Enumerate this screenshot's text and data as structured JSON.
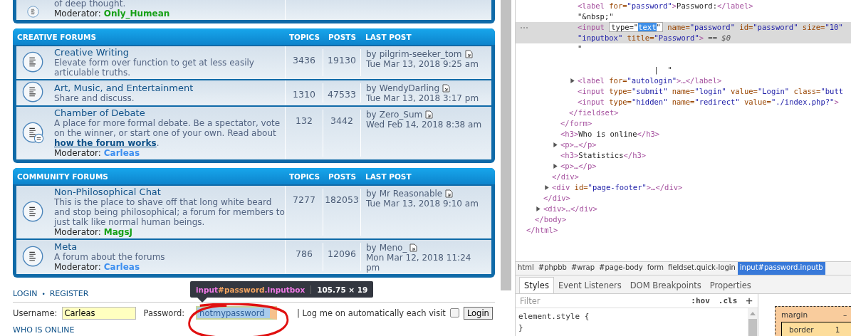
{
  "forum": {
    "categories": [
      {
        "forums": [
          {
            "description": [
              {
                "kind": "text",
                "text": "of deep thought."
              }
            ],
            "moderator_label": "Moderator:",
            "moderator": {
              "name": "Only_Humean",
              "color": "#16a016"
            },
            "has_badge": false
          }
        ]
      },
      {
        "title": "CREATIVE FORUMS",
        "columns": [
          "TOPICS",
          "POSTS",
          "LAST POST"
        ],
        "forums": [
          {
            "name": "Creative Writing",
            "description": [
              {
                "kind": "text",
                "text": "Elevate form over function to get at less easily articulable truths."
              }
            ],
            "has_badge": false,
            "topics": "3436",
            "posts": "19130",
            "last_post": {
              "by": "by",
              "user": "pilgrim-seeker_tom",
              "date": "Tue Mar 13, 2018 9:25 am"
            }
          },
          {
            "name": "Art, Music, and Entertainment",
            "description": [
              {
                "kind": "text",
                "text": "Share and discuss."
              }
            ],
            "has_badge": false,
            "topics": "1310",
            "posts": "47533",
            "last_post": {
              "by": "by",
              "user": "WendyDarling",
              "date": "Tue Mar 13, 2018 3:17 pm"
            }
          },
          {
            "name": "Chamber of Debate",
            "description": [
              {
                "kind": "text",
                "text": "A place for more formal debate. Be a spectator, vote on the winner, or start one of your own. Read about "
              },
              {
                "kind": "link",
                "text": "how the forum works"
              },
              {
                "kind": "text",
                "text": "."
              }
            ],
            "moderator_label": "Moderator:",
            "moderator": {
              "name": "Carleas",
              "color": "#3d8ff0"
            },
            "has_badge": true,
            "topics": "132",
            "posts": "3442",
            "last_post": {
              "by": "by",
              "user": "Zero_Sum",
              "date": "Wed Feb 14, 2018 8:38 am"
            }
          }
        ]
      },
      {
        "title": "COMMUNITY FORUMS",
        "columns": [
          "TOPICS",
          "POSTS",
          "LAST POST"
        ],
        "forums": [
          {
            "name": "Non-Philosophical Chat",
            "description": [
              {
                "kind": "text",
                "text": "This is the place to shave off that long white beard and stop being philosophical; a forum for members to just talk like normal human beings."
              }
            ],
            "moderator_label": "Moderator:",
            "moderator": {
              "name": "MagsJ",
              "color": "#16a016"
            },
            "has_badge": false,
            "topics": "7277",
            "posts": "182053",
            "last_post": {
              "by": "by",
              "user": "Mr Reasonable",
              "date": "Tue Mar 13, 2018 9:10 am"
            }
          },
          {
            "name": "Meta",
            "description": [
              {
                "kind": "text",
                "text": "A forum about the forums"
              }
            ],
            "moderator_label": "Moderator:",
            "moderator": {
              "name": "Carleas",
              "color": "#3d8ff0"
            },
            "has_badge": false,
            "topics": "786",
            "posts": "12096",
            "last_post": {
              "by": "by",
              "user": "Meno_",
              "date": "Mon Mar 12, 2018 11:24 pm"
            }
          }
        ]
      }
    ],
    "login": {
      "links": [
        "LOGIN",
        "REGISTER"
      ],
      "separator": "•",
      "username_label": "Username:",
      "username": "Carleas",
      "password_label": "Password:",
      "password": "notmypassword",
      "autologin_label": "| Log me on automatically each visit",
      "autologin_checked": false,
      "button": "Login"
    },
    "tooltip": {
      "tag": "input",
      "id": "#password",
      "class": ".inputbox",
      "size": "105.75 × 19"
    },
    "next_heading": "WHO IS ONLINE"
  },
  "devtools": {
    "dom_tree": {
      "selected": false,
      "close": [
        {
          "kind": "tag",
          "text": "</html>"
        }
      ],
      "children": [
        {
          "selected": false,
          "close": [
            {
              "kind": "tag",
              "text": "</body>"
            }
          ],
          "children": [
            {
              "selected": false,
              "close": [
                {
                  "kind": "tag",
                  "text": "</div>"
                }
              ],
              "children": [
                {
                  "selected": false,
                  "close": [
                    {
                      "kind": "tag",
                      "text": "</div>"
                    }
                  ],
                  "children": [
                    {
                      "selected": false,
                      "close": [
                        {
                          "kind": "tag",
                          "text": "</form>"
                        }
                      ],
                      "children": [
                        {
                          "selected": false,
                          "close": [
                            {
                              "kind": "tag",
                              "text": "</fieldset>"
                            }
                          ],
                          "children": [
                            {
                              "selected": false,
                              "lines": [
                                [
                                  {
                                    "kind": "tag",
                                    "text": "<label"
                                  },
                                  {
                                    "kind": "attr",
                                    "text": " for="
                                  },
                                  {
                                    "kind": "value",
                                    "text": "\"password\""
                                  },
                                  {
                                    "kind": "tag",
                                    "text": ">"
                                  },
                                  {
                                    "kind": "text",
                                    "text": "Password:"
                                  },
                                  {
                                    "kind": "tag",
                                    "text": "</label>"
                                  }
                                ]
                              ]
                            },
                            {
                              "selected": false,
                              "lines": [
                                [
                                  {
                                    "kind": "text",
                                    "text": "\"&nbsp;\""
                                  }
                                ]
                              ]
                            },
                            {
                              "selected": true,
                              "lines": [
                                [
                                  {
                                    "kind": "tag",
                                    "text": "<input "
                                  },
                                  {
                                    "kind": "editor",
                                    "parts": [
                                      {
                                        "kind": "text",
                                        "text": "type=\""
                                      },
                                      {
                                        "kind": "selection",
                                        "text": "text"
                                      },
                                      {
                                        "kind": "text",
                                        "text": "\""
                                      }
                                    ]
                                  },
                                  {
                                    "kind": "attr",
                                    "text": " name="
                                  },
                                  {
                                    "kind": "value",
                                    "text": "\"password\""
                                  },
                                  {
                                    "kind": "attr",
                                    "text": " id="
                                  },
                                  {
                                    "kind": "value",
                                    "text": "\"password\""
                                  },
                                  {
                                    "kind": "attr",
                                    "text": " size="
                                  },
                                  {
                                    "kind": "value",
                                    "text": "\"10\""
                                  }
                                ],
                                [
                                  {
                                    "kind": "value",
                                    "text": "\"inputbox\""
                                  },
                                  {
                                    "kind": "attr",
                                    "text": " title="
                                  },
                                  {
                                    "kind": "value",
                                    "text": "\"Password\""
                                  },
                                  {
                                    "kind": "tag",
                                    "text": ">"
                                  },
                                  {
                                    "kind": "dim",
                                    "text": " == $0"
                                  }
                                ]
                              ]
                            },
                            {
                              "selected": false,
                              "lines": [
                                [
                                  {
                                    "kind": "text",
                                    "text": "\"\n\n                 |  \""
                                  }
                                ]
                              ]
                            },
                            {
                              "selected": false,
                              "expanded": false,
                              "lines": [
                                [
                                  {
                                    "kind": "tag",
                                    "text": "<label"
                                  },
                                  {
                                    "kind": "attr",
                                    "text": " for="
                                  },
                                  {
                                    "kind": "value",
                                    "text": "\"autologin\""
                                  },
                                  {
                                    "kind": "tag",
                                    "text": ">…</label>"
                                  }
                                ]
                              ]
                            },
                            {
                              "selected": false,
                              "lines": [
                                [
                                  {
                                    "kind": "tag",
                                    "text": "<input"
                                  },
                                  {
                                    "kind": "attr",
                                    "text": " type="
                                  },
                                  {
                                    "kind": "value",
                                    "text": "\"submit\""
                                  },
                                  {
                                    "kind": "attr",
                                    "text": " name="
                                  },
                                  {
                                    "kind": "value",
                                    "text": "\"login\""
                                  },
                                  {
                                    "kind": "attr",
                                    "text": " value="
                                  },
                                  {
                                    "kind": "value",
                                    "text": "\"Login\""
                                  },
                                  {
                                    "kind": "attr",
                                    "text": " class="
                                  },
                                  {
                                    "kind": "value",
                                    "text": "\"butt"
                                  }
                                ]
                              ]
                            },
                            {
                              "selected": false,
                              "lines": [
                                [
                                  {
                                    "kind": "tag",
                                    "text": "<input"
                                  },
                                  {
                                    "kind": "attr",
                                    "text": " type="
                                  },
                                  {
                                    "kind": "value",
                                    "text": "\"hidden\""
                                  },
                                  {
                                    "kind": "attr",
                                    "text": " name="
                                  },
                                  {
                                    "kind": "value",
                                    "text": "\"redirect\""
                                  },
                                  {
                                    "kind": "attr",
                                    "text": " value="
                                  },
                                  {
                                    "kind": "value",
                                    "text": "\"./index.php?\""
                                  },
                                  {
                                    "kind": "tag",
                                    "text": ">"
                                  }
                                ]
                              ]
                            }
                          ]
                        }
                      ]
                    },
                    {
                      "selected": false,
                      "lines": [
                        [
                          {
                            "kind": "tag",
                            "text": "<h3>"
                          },
                          {
                            "kind": "text",
                            "text": "Who is online"
                          },
                          {
                            "kind": "tag",
                            "text": "</h3>"
                          }
                        ]
                      ]
                    },
                    {
                      "selected": false,
                      "expanded": false,
                      "lines": [
                        [
                          {
                            "kind": "tag",
                            "text": "<p>…</p>"
                          }
                        ]
                      ]
                    },
                    {
                      "selected": false,
                      "lines": [
                        [
                          {
                            "kind": "tag",
                            "text": "<h3>"
                          },
                          {
                            "kind": "text",
                            "text": "Statistics"
                          },
                          {
                            "kind": "tag",
                            "text": "</h3>"
                          }
                        ]
                      ]
                    },
                    {
                      "selected": false,
                      "expanded": false,
                      "lines": [
                        [
                          {
                            "kind": "tag",
                            "text": "<p>…</p>"
                          }
                        ]
                      ]
                    }
                  ]
                },
                {
                  "selected": false,
                  "expanded": false,
                  "lines": [
                    [
                      {
                        "kind": "tag",
                        "text": "<div"
                      },
                      {
                        "kind": "attr",
                        "text": " id="
                      },
                      {
                        "kind": "value",
                        "text": "\"page-footer\""
                      },
                      {
                        "kind": "tag",
                        "text": ">…</div>"
                      }
                    ]
                  ]
                }
              ]
            },
            {
              "selected": false,
              "expanded": false,
              "lines": [
                [
                  {
                    "kind": "tag",
                    "text": "<div>…</div>"
                  }
                ]
              ]
            }
          ]
        }
      ]
    },
    "breadcrumbs": [
      {
        "label": "html",
        "selected": false
      },
      {
        "label": "#phpbb",
        "selected": false
      },
      {
        "label": "#wrap",
        "selected": false
      },
      {
        "label": "#page-body",
        "selected": false
      },
      {
        "label": "form",
        "selected": false
      },
      {
        "label": "fieldset.quick-login",
        "selected": false
      },
      {
        "label": "input#password.inputb",
        "selected": true
      }
    ],
    "tabs": [
      {
        "label": "Styles",
        "selected": true
      },
      {
        "label": "Event Listeners",
        "selected": false
      },
      {
        "label": "DOM Breakpoints",
        "selected": false
      },
      {
        "label": "Properties",
        "selected": false
      }
    ],
    "filter": {
      "placeholder": "Filter"
    },
    "filter_buttons": [
      ":hov",
      ".cls",
      "+"
    ],
    "styles_code": [
      "element.style {",
      "}"
    ],
    "box_model": {
      "margin_label": "margin",
      "margin_value": "–",
      "border_label": "border",
      "border_value": "1"
    }
  }
}
